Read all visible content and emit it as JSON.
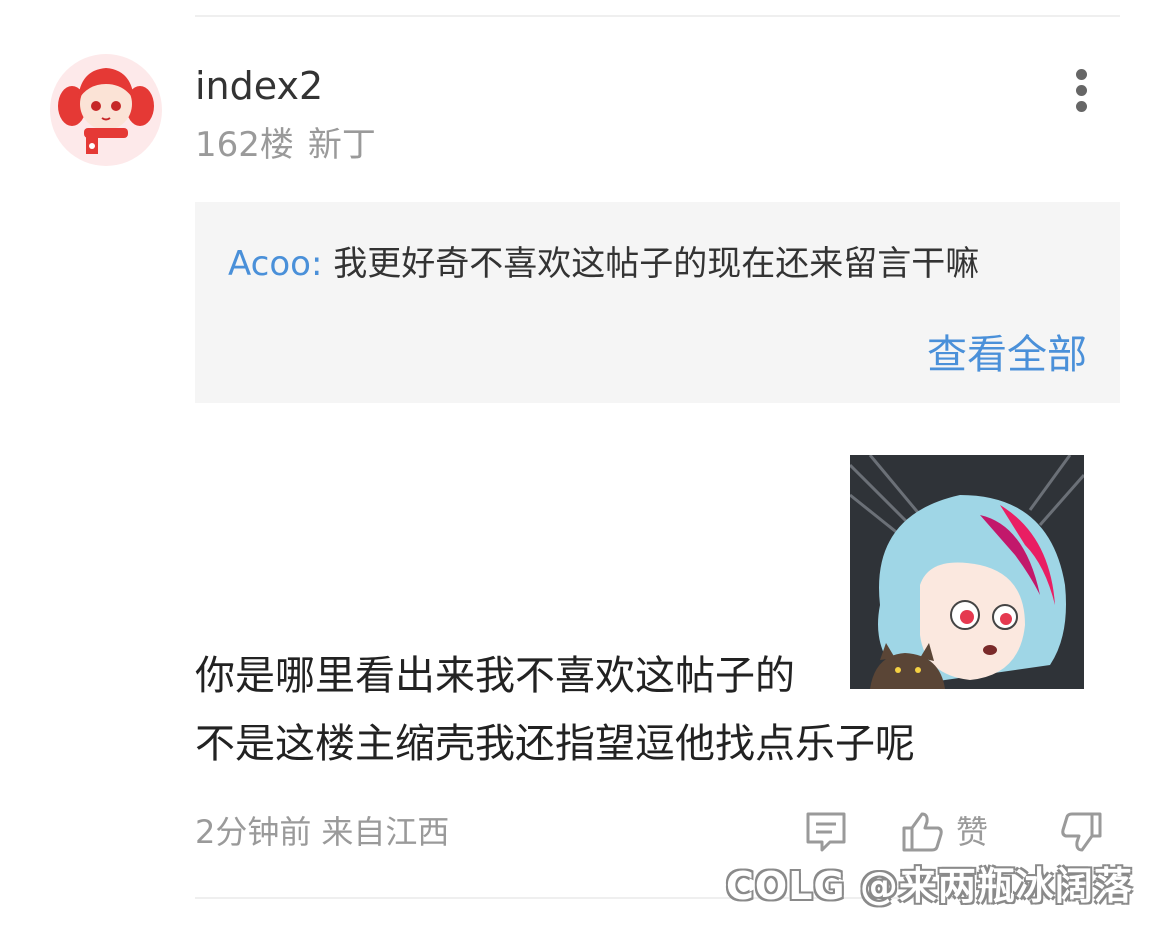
{
  "comment": {
    "username": "index2",
    "floor": "162楼",
    "level": "新丁",
    "quote": {
      "author": "Acoo:",
      "text": "我更好奇不喜欢这帖子的现在还来留言干嘛",
      "view_all_label": "查看全部"
    },
    "body_line_1": "你是哪里看出来我不喜欢这帖子的",
    "body_line_2": "不是这楼主缩壳我还指望逗他找点乐子呢",
    "time": "2分钟前",
    "location": "来自江西",
    "like_label": "赞"
  },
  "watermark": "COLG @来两瓶冰阔落",
  "icons": {
    "more": "more-vertical-icon",
    "reply": "comment-icon",
    "like": "thumbs-up-icon",
    "dislike": "thumbs-down-icon"
  },
  "colors": {
    "accent": "#4a90d9",
    "muted": "#9a9a9a",
    "quote_bg": "#f5f5f5",
    "avatar_bg": "#fde9ea"
  }
}
